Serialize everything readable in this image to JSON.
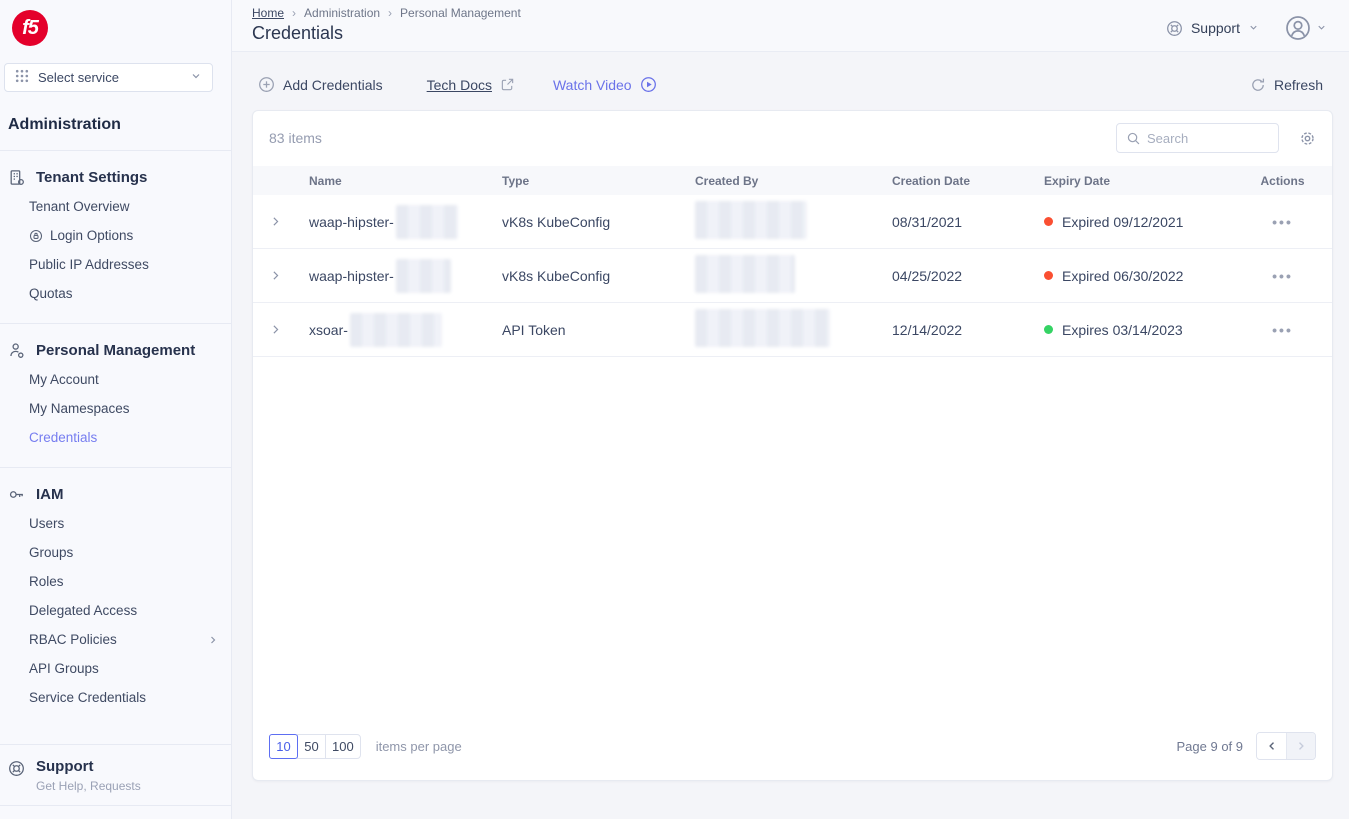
{
  "app": {
    "logo_text": "f5"
  },
  "sidebar": {
    "select_service": {
      "label": "Select service"
    },
    "title": "Administration",
    "groups": [
      {
        "title": "Tenant Settings",
        "items": [
          {
            "label": "Tenant Overview"
          },
          {
            "label": "Login Options"
          },
          {
            "label": "Public IP Addresses"
          },
          {
            "label": "Quotas"
          }
        ]
      },
      {
        "title": "Personal Management",
        "items": [
          {
            "label": "My Account"
          },
          {
            "label": "My Namespaces"
          },
          {
            "label": "Credentials"
          }
        ]
      },
      {
        "title": "IAM",
        "items": [
          {
            "label": "Users"
          },
          {
            "label": "Groups"
          },
          {
            "label": "Roles"
          },
          {
            "label": "Delegated Access"
          },
          {
            "label": "RBAC Policies"
          },
          {
            "label": "API Groups"
          },
          {
            "label": "Service Credentials"
          }
        ]
      }
    ],
    "support": {
      "title": "Support",
      "subtitle": "Get Help, Requests"
    }
  },
  "header": {
    "breadcrumb": {
      "home": "Home",
      "section": "Administration",
      "subsection": "Personal Management",
      "separator": "›"
    },
    "title": "Credentials",
    "support_label": "Support"
  },
  "toolbar": {
    "add_credentials": "Add Credentials",
    "tech_docs": "Tech Docs",
    "watch_video": "Watch Video",
    "refresh": "Refresh"
  },
  "table": {
    "items_count": "83 items",
    "search_placeholder": "Search",
    "columns": [
      "Name",
      "Type",
      "Created By",
      "Creation Date",
      "Expiry Date",
      "Actions"
    ],
    "actions_glyph": "•••",
    "rows": [
      {
        "name": "waap-hipster-",
        "type": "vK8s KubeConfig",
        "creation_date": "08/31/2021",
        "expiry_text": "Expired 09/12/2021",
        "status": "expired"
      },
      {
        "name": "waap-hipster-",
        "type": "vK8s KubeConfig",
        "creation_date": "04/25/2022",
        "expiry_text": "Expired 06/30/2022",
        "status": "expired"
      },
      {
        "name": "xsoar-",
        "type": "API Token",
        "creation_date": "12/14/2022",
        "expiry_text": "Expires 03/14/2023",
        "status": "valid"
      }
    ]
  },
  "pagination": {
    "sizes": [
      "10",
      "50",
      "100"
    ],
    "selected_size": "10",
    "items_per_page": "items per page",
    "page_info": "Page 9 of 9"
  },
  "colors": {
    "accent_link": "#767df0",
    "expired_dot": "#fa4f32",
    "valid_dot": "#35d364",
    "logo_red": "#e4002b"
  }
}
